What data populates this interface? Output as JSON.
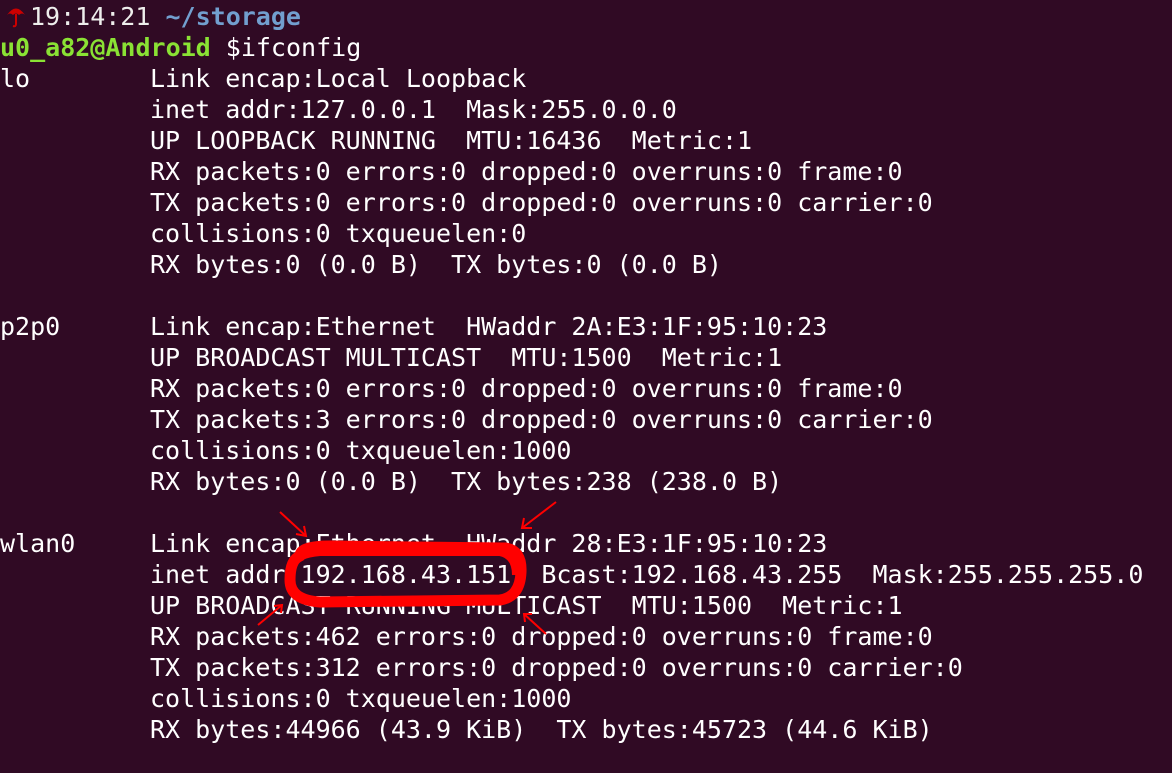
{
  "prompt": {
    "time": "19:14:21",
    "path": "~/storage",
    "user_host": "u0_a82@Android",
    "command": "$ifconfig"
  },
  "interfaces": [
    {
      "name": "lo",
      "lines": [
        "Link encap:Local Loopback",
        "inet addr:127.0.0.1  Mask:255.0.0.0",
        "UP LOOPBACK RUNNING  MTU:16436  Metric:1",
        "RX packets:0 errors:0 dropped:0 overruns:0 frame:0",
        "TX packets:0 errors:0 dropped:0 overruns:0 carrier:0",
        "collisions:0 txqueuelen:0",
        "RX bytes:0 (0.0 B)  TX bytes:0 (0.0 B)"
      ]
    },
    {
      "name": "p2p0",
      "lines": [
        "Link encap:Ethernet  HWaddr 2A:E3:1F:95:10:23",
        "UP BROADCAST MULTICAST  MTU:1500  Metric:1",
        "RX packets:0 errors:0 dropped:0 overruns:0 frame:0",
        "TX packets:3 errors:0 dropped:0 overruns:0 carrier:0",
        "collisions:0 txqueuelen:1000",
        "RX bytes:0 (0.0 B)  TX bytes:238 (238.0 B)"
      ]
    },
    {
      "name": "wlan0",
      "lines": [
        "Link encap:Ethernet  HWaddr 28:E3:1F:95:10:23",
        "inet addr:192.168.43.151  Bcast:192.168.43.255  Mask:255.255.255.0",
        "UP BROADCAST RUNNING MULTICAST  MTU:1500  Metric:1",
        "RX packets:462 errors:0 dropped:0 overruns:0 frame:0",
        "TX packets:312 errors:0 dropped:0 overruns:0 carrier:0",
        "collisions:0 txqueuelen:1000",
        "RX bytes:44966 (43.9 KiB)  TX bytes:45723 (44.6 KiB)"
      ]
    }
  ],
  "colors": {
    "background": "#300a24",
    "text": "#ffffff",
    "path": "#729fcf",
    "user": "#8ae234",
    "annotation": "#ff0000"
  },
  "icons": {
    "prompt_icon": "umbrella-icon"
  }
}
